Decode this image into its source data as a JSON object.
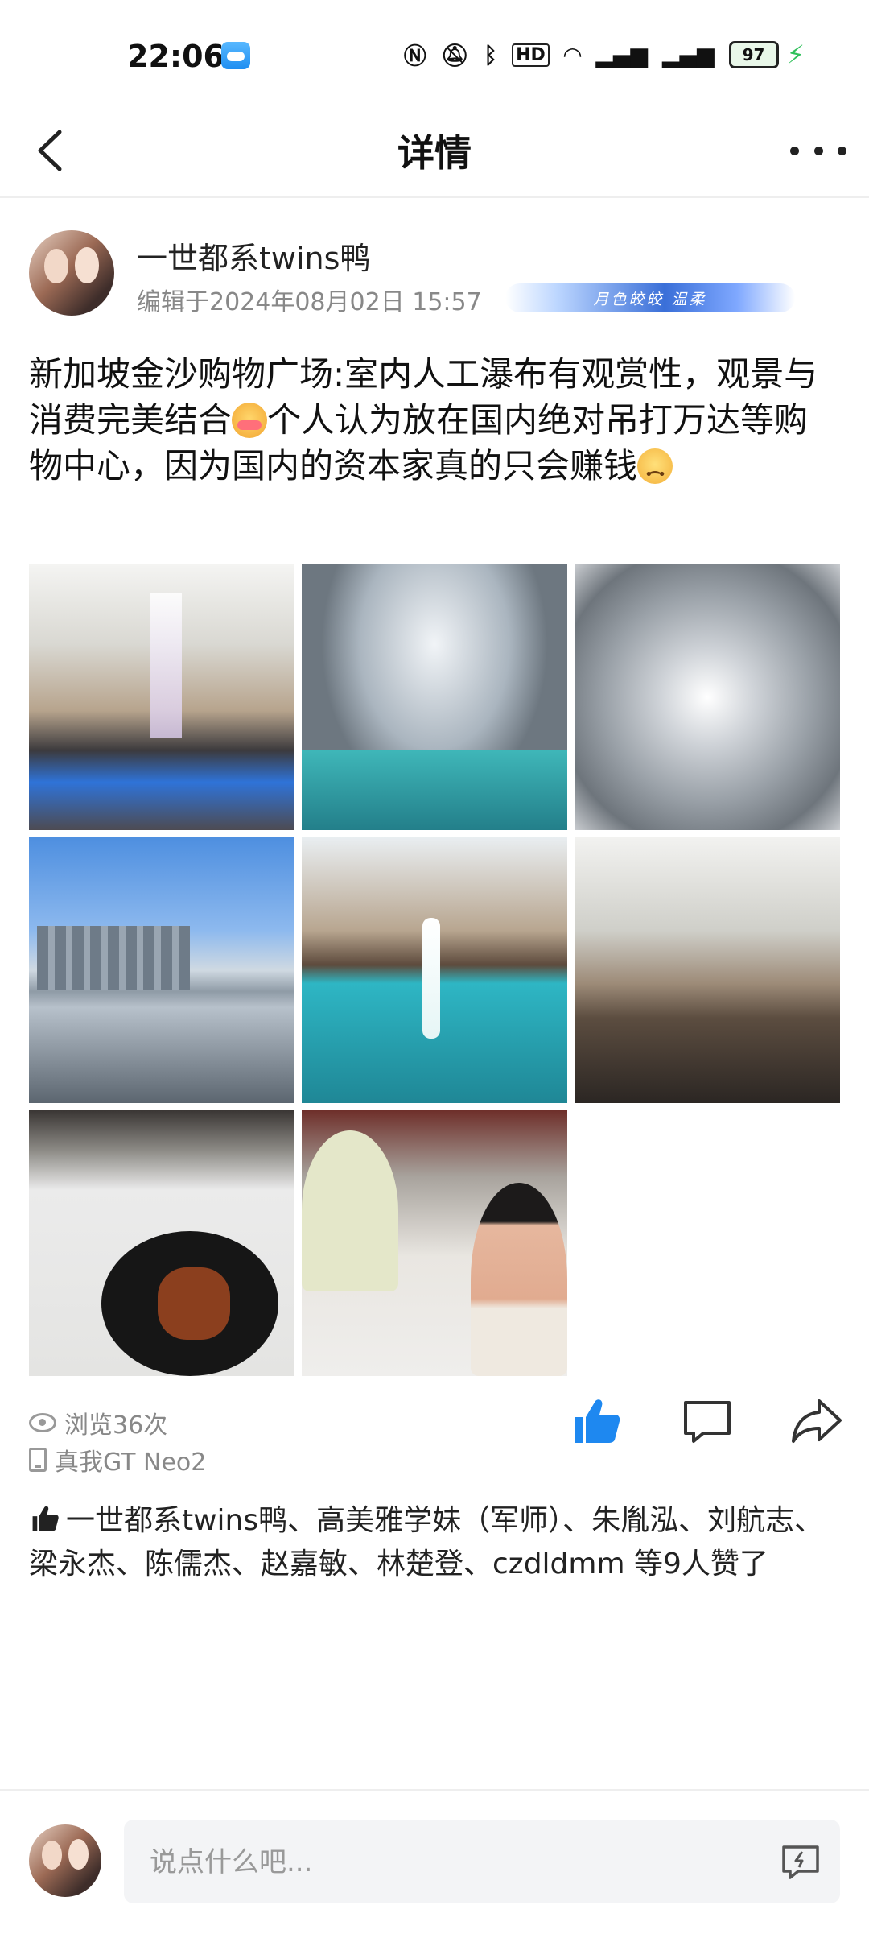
{
  "status_bar": {
    "time": "22:06",
    "battery": "97"
  },
  "nav": {
    "title": "详情"
  },
  "author": {
    "name": "一世都系twins鸭",
    "edited": "编辑于2024年08月02日 15:57",
    "badge_text": "月色皎皎 温柔"
  },
  "post": {
    "text_1": "新加坡金沙购物广场:室内人工瀑布有观赏性，观景与消费完美结合",
    "text_2": "个人认为放在国内绝对吊打万达等购物中心，因为国内的资本家真的只会赚钱",
    "photos": [
      "购物中心中庭瀑布",
      "玻璃穹顶与水池",
      "雨水漩涡",
      "滨海湾城市天际线",
      "喷泉与游船",
      "商场餐饮区",
      "餐盘与牛排",
      "两位男士合影"
    ]
  },
  "stats": {
    "views": "浏览36次",
    "device": "真我GT Neo2"
  },
  "likes": {
    "text": "一世都系twins鸭、高美雅学妹（军师）、朱胤泓、刘航志、梁永杰、陈儒杰、赵嘉敏、林楚登、czdldmm 等9人赞了"
  },
  "comment": {
    "placeholder": "说点什么吧..."
  },
  "colors": {
    "accent": "#1e88f0",
    "muted": "#888888"
  }
}
